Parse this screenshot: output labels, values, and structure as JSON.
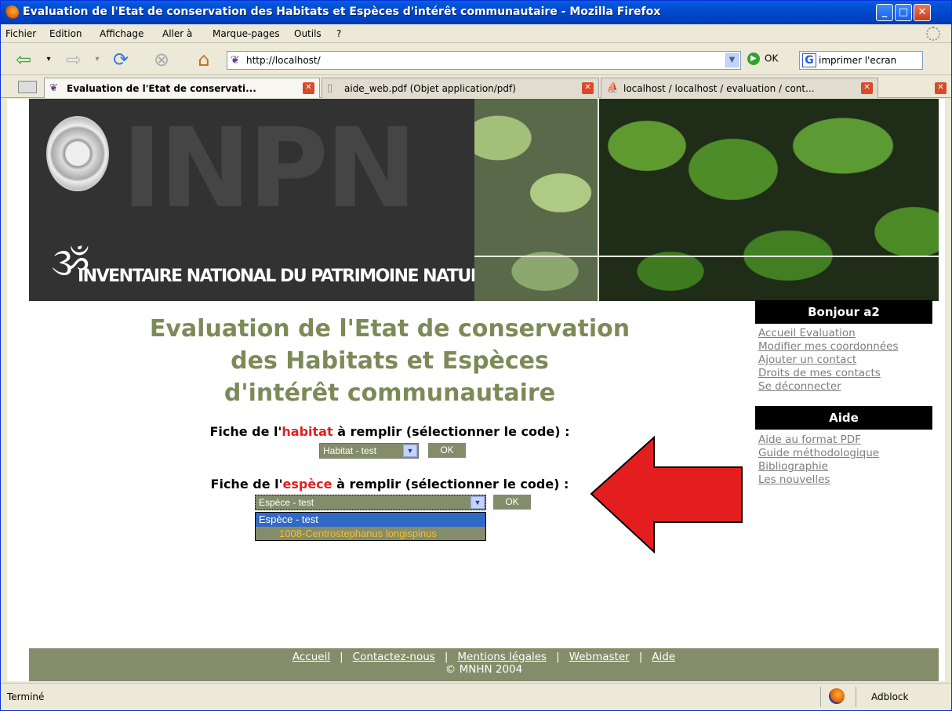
{
  "window": {
    "title": "Evaluation de l'Etat de conservation des Habitats et Espèces d'intérêt communautaire - Mozilla Firefox"
  },
  "menu": {
    "items": [
      "Fichier",
      "Edition",
      "Affichage",
      "Aller à",
      "Marque-pages",
      "Outils",
      "?"
    ]
  },
  "nav": {
    "url": "http://localhost/",
    "go_label": "OK",
    "search_value": "imprimer l'ecran"
  },
  "tabs": [
    {
      "label": "Evaluation de l'Etat de conservati...",
      "active": true
    },
    {
      "label": "aide_web.pdf (Objet application/pdf)",
      "active": false
    },
    {
      "label": "localhost / localhost / evaluation  / cont...",
      "active": false
    }
  ],
  "banner": {
    "logo_text": "INPN",
    "subtitle": "INVENTAIRE NATIONAL DU PATRIMOINE NATUREL"
  },
  "main": {
    "title_lines": [
      "Evaluation de l'Etat de conservation",
      "des Habitats et Espèces",
      "d'intérêt communautaire"
    ],
    "habitat": {
      "label_pre": "Fiche de l'",
      "label_hl": "habitat",
      "label_post": " à remplir (sélectionner le code) :",
      "selected": "Habitat - test",
      "ok": "OK"
    },
    "espece": {
      "label_pre": "Fiche de l'",
      "label_hl": "espèce",
      "label_post": " à remplir (sélectionner le code) :",
      "selected": "Espèce - test",
      "ok": "OK",
      "options": [
        "Espèce - test",
        "1008-Centrostephanus longispinus"
      ]
    }
  },
  "sidebar": {
    "greeting": "Bonjour a2",
    "links": [
      "Accueil Evaluation",
      "Modifier mes coordonnées",
      "Ajouter un contact",
      "Droits de mes contacts",
      "Se déconnecter"
    ],
    "aide_title": "Aide",
    "aide_links": [
      "Aide au format PDF",
      "Guide méthodologique",
      "Bibliographie",
      "Les nouvelles"
    ]
  },
  "footer": {
    "links": [
      "Accueil",
      "Contactez-nous",
      "Mentions légales",
      "Webmaster",
      "Aide"
    ],
    "copyright": "© MNHN 2004"
  },
  "status": {
    "text": "Terminé",
    "addon": "Adblock"
  },
  "colors": {
    "accent_olive": "#858c6a",
    "title_olive": "#7d8a58",
    "highlight_red": "#e02020",
    "arrow_red": "#e41e1e"
  }
}
